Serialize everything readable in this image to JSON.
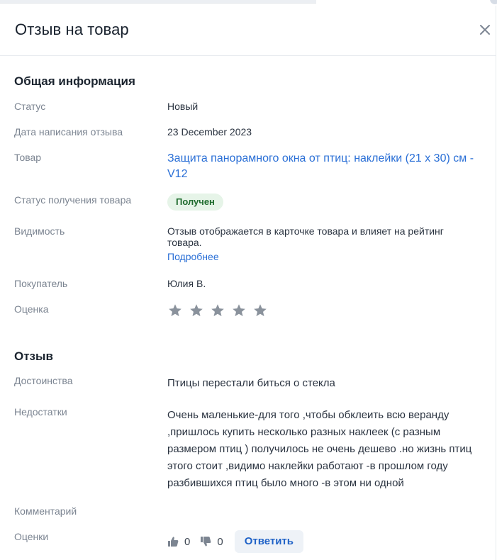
{
  "header": {
    "title": "Отзыв на товар",
    "close_icon": "close-icon"
  },
  "general": {
    "section_title": "Общая информация",
    "status_label": "Статус",
    "status_value": "Новый",
    "date_label": "Дата написания отзыва",
    "date_value": "23 December 2023",
    "product_label": "Товар",
    "product_name": "Защита панорамного окна от птиц: наклейки (21 x 30) см - V12",
    "receipt_label": "Статус получения товара",
    "receipt_badge": "Получен",
    "visibility_label": "Видимость",
    "visibility_text": "Отзыв отображается в карточке товара и влияет на рейтинг товара.",
    "visibility_link": "Подробнее",
    "buyer_label": "Покупатель",
    "buyer_name": "Юлия В.",
    "rating_label": "Оценка",
    "rating_value": 0,
    "rating_max": 5
  },
  "review": {
    "section_title": "Отзыв",
    "pros_label": "Достоинства",
    "pros_text": "Птицы перестали биться о стекла",
    "cons_label": "Недостатки",
    "cons_text": "Очень маленькие-для того ,чтобы обклеить всю веранду ,пришлось купить несколько разных наклеек (с разным размером птиц ) получилось не очень дешево .но жизнь птиц этого стоит ,видимо наклейки работают -в прошлом году разбившихся птиц было много -в этом ни одной",
    "comment_label": "Комментарий",
    "ratings_label": "Оценки",
    "likes": "0",
    "dislikes": "0",
    "reply_button": "Ответить"
  },
  "colors": {
    "link": "#2a6fd6",
    "badge_bg": "#e6f4e8",
    "badge_text": "#1e6b2d",
    "star": "#8a929c",
    "button_bg": "#eef2f7"
  }
}
